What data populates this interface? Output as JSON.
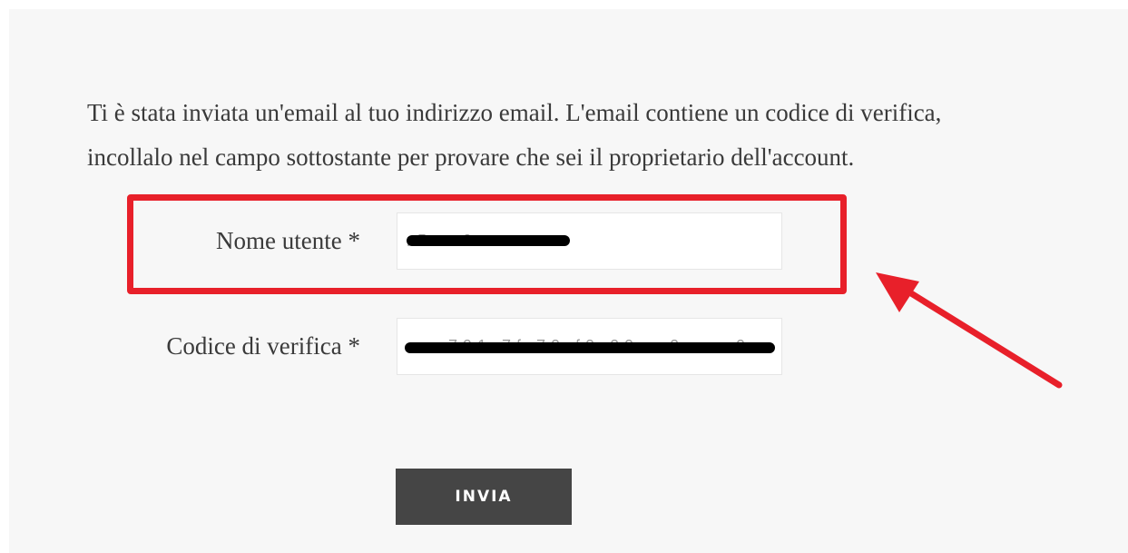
{
  "form": {
    "intro_line1": "Ti è stata inviata un'email al tuo indirizzo email. L'email contiene un codice di verifica,",
    "intro_line2": "incollalo nel campo sottostante per provare che sei il proprietario dell'account.",
    "username_label": "Nome utente *",
    "username_value": "r5 · 9 ·····",
    "code_label": "Codice di verifica *",
    "code_value": "· · 791 7f 70 f0 09 · 0 · · 9 · · 01",
    "submit_label": "INVIA"
  },
  "annotation": {
    "highlight_color": "#e8202a",
    "highlight_target": "username-field",
    "arrow_icon": "arrow-icon"
  },
  "colors": {
    "panel_background": "#f7f7f7",
    "text": "#3a3a3a",
    "button_background": "#454545",
    "button_text": "#ffffff"
  }
}
